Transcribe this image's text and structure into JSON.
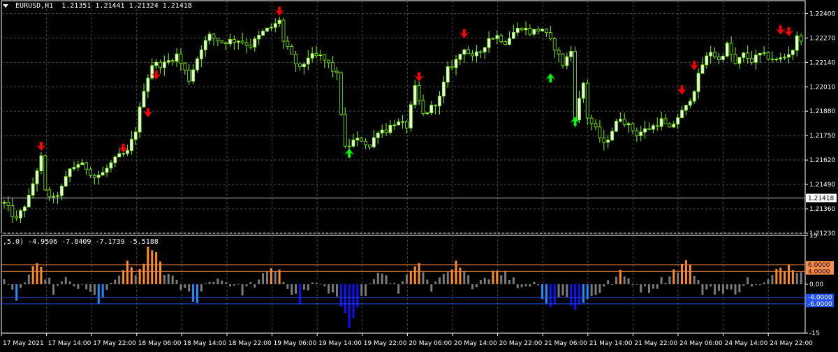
{
  "header": {
    "symbol_label": "EURUSD,H1",
    "ohlc_label": "1.21351 1.21441 1.21324 1.21418"
  },
  "indicator_header": ",5.0) -4.9506 -7.8409 -7.1739 -5.5188",
  "colors": {
    "background": "#000000",
    "grid": "#4a4a4a",
    "candle_up": "#e9ffe0",
    "wick": "#7cfc00",
    "candle_down": "#000000",
    "arrow_down": "#ff0000",
    "arrow_up": "#00ff00",
    "hist_orange": "#ff8c1a",
    "hist_gray": "#7a7a7a",
    "hist_blue": "#1e90ff",
    "hist_navy": "#1010ff",
    "level_orange": "#ff8c4a",
    "level_blue": "#2050ff",
    "axis_text": "#ffffff"
  },
  "chart_data": [
    {
      "type": "candlestick",
      "title": "EURUSD,H1",
      "current_price": "1.21418",
      "ylim": [
        1.2123,
        1.2245
      ],
      "y_ticks": [
        "1.22400",
        "1.22270",
        "1.22140",
        "1.22010",
        "1.21880",
        "1.21750",
        "1.21620",
        "1.21490",
        "1.21360",
        "1.21230"
      ],
      "x_ticks": [
        "17 May 2021",
        "17 May 14:00",
        "17 May 22:00",
        "18 May 06:00",
        "18 May 14:00",
        "18 May 22:00",
        "19 May 06:00",
        "19 May 14:00",
        "19 May 22:00",
        "20 May 06:00",
        "20 May 14:00",
        "20 May 22:00",
        "21 May 06:00",
        "21 May 14:00",
        "21 May 22:00",
        "24 May 06:00",
        "24 May 14:00",
        "24 May 22:00"
      ],
      "close_path": [
        [
          0,
          1.2139
        ],
        [
          3,
          1.213
        ],
        [
          6,
          1.2142
        ],
        [
          8,
          1.2157
        ],
        [
          9,
          1.2163
        ],
        [
          10,
          1.2145
        ],
        [
          12,
          1.2141
        ],
        [
          14,
          1.2147
        ],
        [
          16,
          1.2157
        ],
        [
          18,
          1.216
        ],
        [
          20,
          1.2158
        ],
        [
          22,
          1.2153
        ],
        [
          24,
          1.2155
        ],
        [
          26,
          1.216
        ],
        [
          28,
          1.2164
        ],
        [
          30,
          1.2166
        ],
        [
          32,
          1.2178
        ],
        [
          34,
          1.22
        ],
        [
          36,
          1.2213
        ],
        [
          39,
          1.2213
        ],
        [
          42,
          1.2218
        ],
        [
          45,
          1.2205
        ],
        [
          48,
          1.2222
        ],
        [
          50,
          1.2228
        ],
        [
          53,
          1.2225
        ],
        [
          57,
          1.2226
        ],
        [
          60,
          1.2223
        ],
        [
          63,
          1.223
        ],
        [
          66,
          1.2234
        ],
        [
          67,
          1.2237
        ],
        [
          68,
          1.2225
        ],
        [
          70,
          1.2217
        ],
        [
          72,
          1.221
        ],
        [
          74,
          1.2217
        ],
        [
          77,
          1.2217
        ],
        [
          79,
          1.2213
        ],
        [
          81,
          1.2207
        ],
        [
          83,
          1.2168
        ],
        [
          85,
          1.2172
        ],
        [
          87,
          1.2173
        ],
        [
          89,
          1.2169
        ],
        [
          91,
          1.2178
        ],
        [
          93,
          1.2178
        ],
        [
          95,
          1.2182
        ],
        [
          98,
          1.218
        ],
        [
          100,
          1.22
        ],
        [
          102,
          1.2186
        ],
        [
          104,
          1.219
        ],
        [
          106,
          1.2195
        ],
        [
          108,
          1.221
        ],
        [
          110,
          1.2215
        ],
        [
          112,
          1.2222
        ],
        [
          114,
          1.2216
        ],
        [
          116,
          1.222
        ],
        [
          118,
          1.2227
        ],
        [
          120,
          1.2228
        ],
        [
          122,
          1.2225
        ],
        [
          124,
          1.223
        ],
        [
          126,
          1.2233
        ],
        [
          128,
          1.223
        ],
        [
          131,
          1.2232
        ],
        [
          133,
          1.2225
        ],
        [
          134,
          1.2222
        ],
        [
          136,
          1.2213
        ],
        [
          138,
          1.222
        ],
        [
          139,
          1.2185
        ],
        [
          141,
          1.2203
        ],
        [
          142,
          1.2185
        ],
        [
          144,
          1.2178
        ],
        [
          146,
          1.217
        ],
        [
          148,
          1.2178
        ],
        [
          150,
          1.2185
        ],
        [
          152,
          1.218
        ],
        [
          154,
          1.2176
        ],
        [
          156,
          1.2178
        ],
        [
          158,
          1.218
        ],
        [
          160,
          1.2183
        ],
        [
          162,
          1.2178
        ],
        [
          164,
          1.2185
        ],
        [
          166,
          1.219
        ],
        [
          168,
          1.22
        ],
        [
          170,
          1.2213
        ],
        [
          172,
          1.222
        ],
        [
          174,
          1.2215
        ],
        [
          176,
          1.2223
        ],
        [
          178,
          1.2213
        ],
        [
          180,
          1.2218
        ],
        [
          182,
          1.2215
        ],
        [
          184,
          1.2218
        ],
        [
          186,
          1.2217
        ],
        [
          188,
          1.2215
        ],
        [
          190,
          1.2217
        ],
        [
          192,
          1.2221
        ],
        [
          193,
          1.2227
        ]
      ],
      "signals": [
        {
          "index": 9,
          "type": "sell",
          "price": 1.2168
        },
        {
          "index": 29,
          "type": "sell",
          "price": 1.2167
        },
        {
          "index": 35,
          "type": "sell",
          "price": 1.2186
        },
        {
          "index": 37,
          "type": "sell",
          "price": 1.2206
        },
        {
          "index": 67,
          "type": "sell",
          "price": 1.224
        },
        {
          "index": 84,
          "type": "buy",
          "price": 1.2167
        },
        {
          "index": 101,
          "type": "sell",
          "price": 1.2205
        },
        {
          "index": 112,
          "type": "sell",
          "price": 1.2228
        },
        {
          "index": 133,
          "type": "buy",
          "price": 1.2207
        },
        {
          "index": 139,
          "type": "buy",
          "price": 1.2184
        },
        {
          "index": 165,
          "type": "sell",
          "price": 1.2198
        },
        {
          "index": 168,
          "type": "sell",
          "price": 1.2211
        },
        {
          "index": 189,
          "type": "sell",
          "price": 1.223
        },
        {
          "index": 191,
          "type": "sell",
          "price": 1.2229
        }
      ]
    },
    {
      "type": "bar",
      "title": ",5.0) -4.9506 -7.8409 -7.1739 -5.5188",
      "ylim": [
        -15,
        15
      ],
      "y_ticks": [
        "15",
        "0.00",
        "-15"
      ],
      "levels": [
        "6.0000",
        "4.0000",
        "-4.0000",
        "-6.0000"
      ],
      "level_values": [
        6,
        4,
        -4,
        -6
      ],
      "hist_profile": [
        [
          0,
          0
        ],
        [
          3,
          -4
        ],
        [
          6,
          3
        ],
        [
          8,
          5
        ],
        [
          10,
          3
        ],
        [
          12,
          -2
        ],
        [
          15,
          1
        ],
        [
          20,
          -2
        ],
        [
          23,
          -5
        ],
        [
          26,
          -1
        ],
        [
          28,
          3
        ],
        [
          30,
          6
        ],
        [
          32,
          2
        ],
        [
          35,
          10
        ],
        [
          37,
          10
        ],
        [
          39,
          4
        ],
        [
          42,
          0
        ],
        [
          45,
          -3
        ],
        [
          47,
          -5
        ],
        [
          49,
          0
        ],
        [
          51,
          2
        ],
        [
          54,
          1
        ],
        [
          58,
          -2
        ],
        [
          62,
          1
        ],
        [
          65,
          4
        ],
        [
          67,
          5
        ],
        [
          68,
          1
        ],
        [
          70,
          -3
        ],
        [
          72,
          -5
        ],
        [
          74,
          -1
        ],
        [
          77,
          0
        ],
        [
          79,
          -3
        ],
        [
          81,
          -5
        ],
        [
          83,
          -8
        ],
        [
          84,
          -12
        ],
        [
          86,
          -6
        ],
        [
          88,
          -3
        ],
        [
          90,
          2
        ],
        [
          92,
          4
        ],
        [
          94,
          0
        ],
        [
          96,
          -2
        ],
        [
          98,
          3
        ],
        [
          100,
          7
        ],
        [
          102,
          3
        ],
        [
          104,
          -2
        ],
        [
          106,
          1
        ],
        [
          108,
          3
        ],
        [
          110,
          6
        ],
        [
          112,
          3
        ],
        [
          114,
          0
        ],
        [
          117,
          2
        ],
        [
          120,
          5
        ],
        [
          123,
          2
        ],
        [
          126,
          -1
        ],
        [
          129,
          1
        ],
        [
          131,
          -3
        ],
        [
          133,
          -7
        ],
        [
          135,
          -4
        ],
        [
          137,
          -4
        ],
        [
          139,
          -7
        ],
        [
          141,
          -6
        ],
        [
          143,
          -3
        ],
        [
          145,
          -2
        ],
        [
          147,
          0
        ],
        [
          150,
          3
        ],
        [
          153,
          1
        ],
        [
          156,
          -2
        ],
        [
          159,
          0
        ],
        [
          162,
          3
        ],
        [
          165,
          6
        ],
        [
          167,
          7
        ],
        [
          168,
          2
        ],
        [
          170,
          -2
        ],
        [
          172,
          -1
        ],
        [
          175,
          -3
        ],
        [
          178,
          -2
        ],
        [
          181,
          1
        ],
        [
          184,
          -1
        ],
        [
          187,
          2
        ],
        [
          189,
          5
        ],
        [
          191,
          6
        ],
        [
          193,
          5
        ]
      ]
    }
  ]
}
